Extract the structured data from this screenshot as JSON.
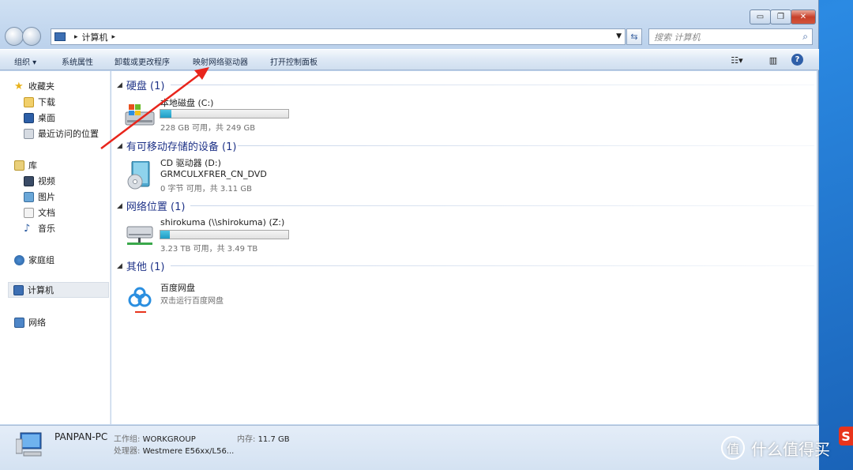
{
  "window": {
    "controls": {
      "minimize": "▭",
      "maximize": "❐",
      "close": "✕"
    }
  },
  "navbar": {
    "breadcrumb": [
      "计算机"
    ],
    "search_placeholder": "搜索 计算机"
  },
  "toolbar": {
    "items": [
      "组织 ▾",
      "系统属性",
      "卸载或更改程序",
      "映射网络驱动器",
      "打开控制面板"
    ],
    "help": "?"
  },
  "sidebar": {
    "favorites": {
      "label": "收藏夹",
      "items": [
        "下载",
        "桌面",
        "最近访问的位置"
      ]
    },
    "libraries": {
      "label": "库",
      "items": [
        "视频",
        "图片",
        "文档",
        "音乐"
      ]
    },
    "homegroup": "家庭组",
    "computer": "计算机",
    "network": "网络"
  },
  "content": {
    "groups": [
      {
        "title": "硬盘 (1)"
      },
      {
        "title": "有可移动存储的设备 (1)"
      },
      {
        "title": "网络位置 (1)"
      },
      {
        "title": "其他 (1)"
      }
    ],
    "drives": {
      "c": {
        "name": "本地磁盘 (C:)",
        "info": "228 GB 可用，共 249 GB",
        "used_fraction": 0.084
      },
      "d": {
        "name": "CD 驱动器 (D:)",
        "label": "GRMCULXFRER_CN_DVD",
        "info": "0 字节 可用，共 3.11 GB"
      },
      "z": {
        "name": "shirokuma (\\\\shirokuma) (Z:)",
        "info": "3.23 TB 可用，共 3.49 TB",
        "used_fraction": 0.075
      },
      "baidu": {
        "name": "百度网盘",
        "info": "双击运行百度网盘"
      }
    }
  },
  "status": {
    "pc_name": "PANPAN-PC",
    "workgroup_key": "工作组:",
    "workgroup_val": "WORKGROUP",
    "memory_key": "内存:",
    "memory_val": "11.7 GB",
    "cpu_key": "处理器:",
    "cpu_val": "Westmere E56xx/L56..."
  },
  "overlay": {
    "watermark": "什么值得买",
    "watermark_icon": "值",
    "sohu": "S"
  },
  "colors": {
    "accent": "#1e3287",
    "bar_fill": "#1e9cc4",
    "arrow": "#e8251c"
  }
}
